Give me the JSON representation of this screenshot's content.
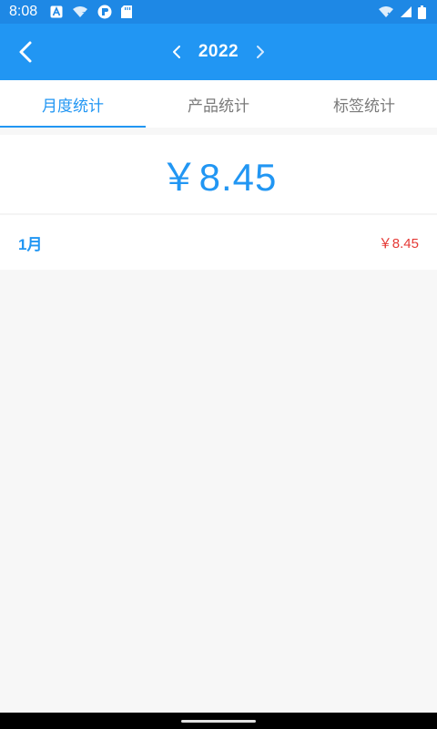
{
  "status_bar": {
    "time": "8:08",
    "left_icons": [
      "a-notification-icon",
      "wifi-question-icon",
      "app-notification-icon",
      "sd-card-icon"
    ],
    "right_icons": [
      "wifi-x-icon",
      "signal-icon",
      "battery-icon"
    ]
  },
  "app_bar": {
    "back_icon": "chevron-left-icon",
    "year": "2022",
    "prev_icon": "chevron-left-icon",
    "next_icon": "chevron-right-icon",
    "background_color": "#2196f3"
  },
  "tabs": [
    {
      "label": "月度统计",
      "active": true
    },
    {
      "label": "产品统计",
      "active": false
    },
    {
      "label": "标签统计",
      "active": false
    }
  ],
  "summary": {
    "total": "￥8.45",
    "color": "#2196f3"
  },
  "months": [
    {
      "label": "1月",
      "amount": "￥8.45",
      "amount_color": "#e53935"
    }
  ]
}
